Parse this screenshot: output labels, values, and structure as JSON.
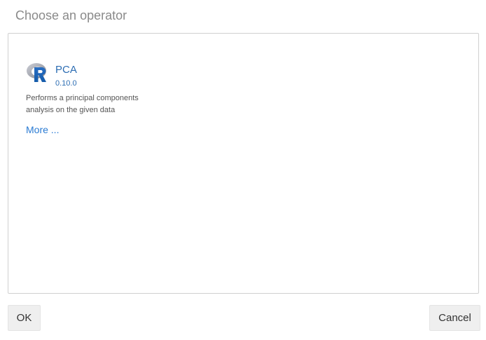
{
  "dialog": {
    "title": "Choose an operator"
  },
  "operators": [
    {
      "icon": "r-language-icon",
      "name": "PCA",
      "version": "0.10.0",
      "description": "Performs a principal components analysis on the given data",
      "more_label": "More ..."
    }
  ],
  "footer": {
    "ok_label": "OK",
    "cancel_label": "Cancel"
  },
  "colors": {
    "link": "#2a7bd3",
    "title": "#8a8a8a",
    "button_bg": "#efefef",
    "border": "#d0d0d0"
  }
}
